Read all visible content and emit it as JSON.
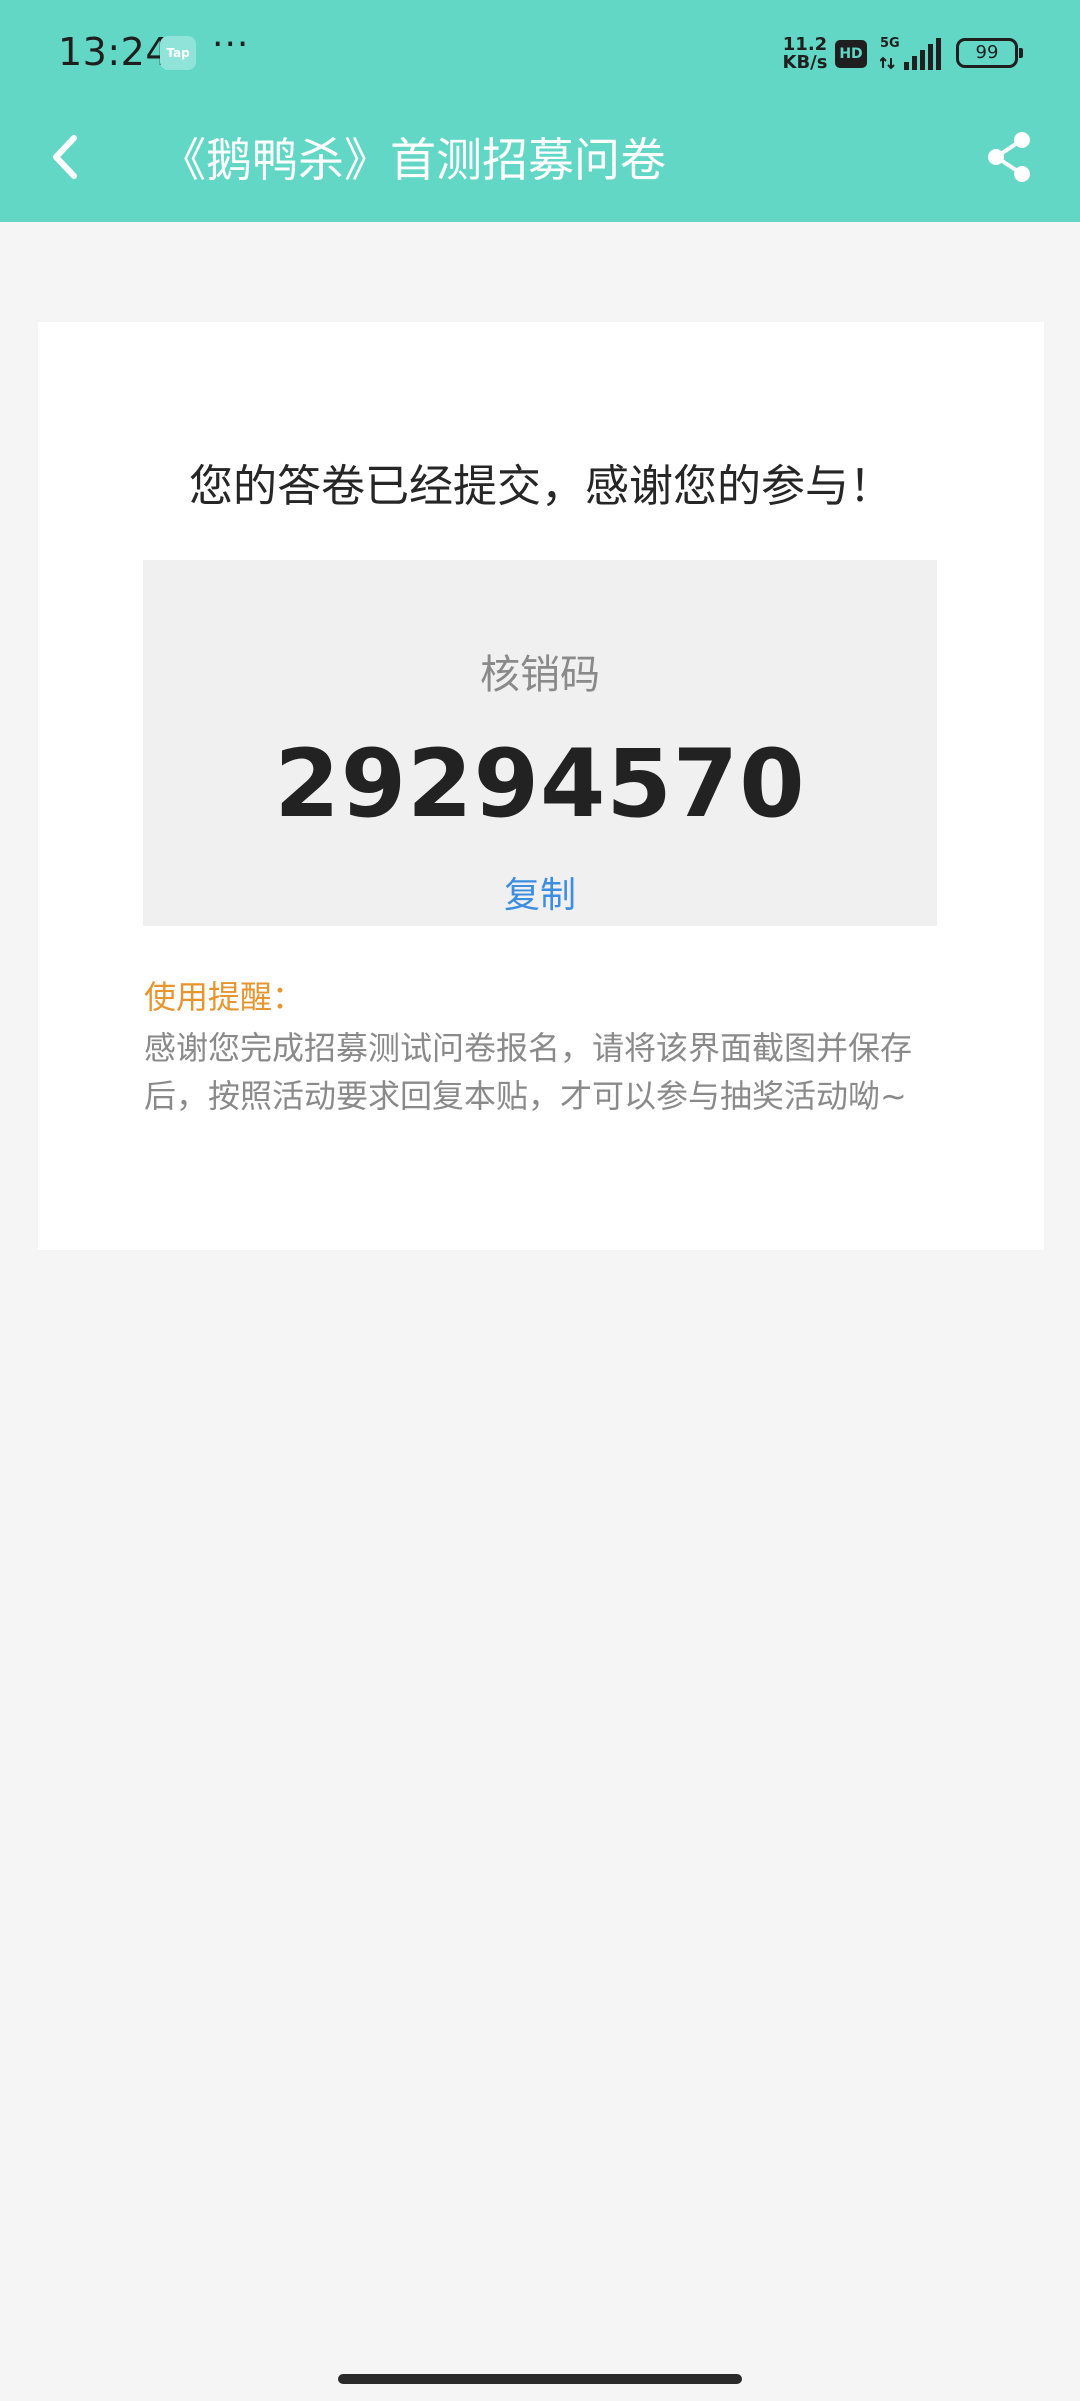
{
  "status_bar": {
    "time": "13:24",
    "app_badge": "Tap",
    "more": "···",
    "net_speed_value": "11.2",
    "net_speed_unit": "KB/s",
    "hd": "HD",
    "network": "5G",
    "battery": "99"
  },
  "header": {
    "title": "《鹅鸭杀》首测招募问卷"
  },
  "card": {
    "success_message": "您的答卷已经提交，感谢您的参与！",
    "code_label": "核销码",
    "code_value": "29294570",
    "copy_label": "复制",
    "reminder_title": "使用提醒：",
    "reminder_text": "感谢您完成招募测试问卷报名，请将该界面截图并保存后，按照活动要求回复本贴，才可以参与抽奖活动呦~"
  },
  "colors": {
    "header_bg": "#63d7c6",
    "accent_link": "#3d8ee0",
    "reminder_title": "#e6952f"
  }
}
